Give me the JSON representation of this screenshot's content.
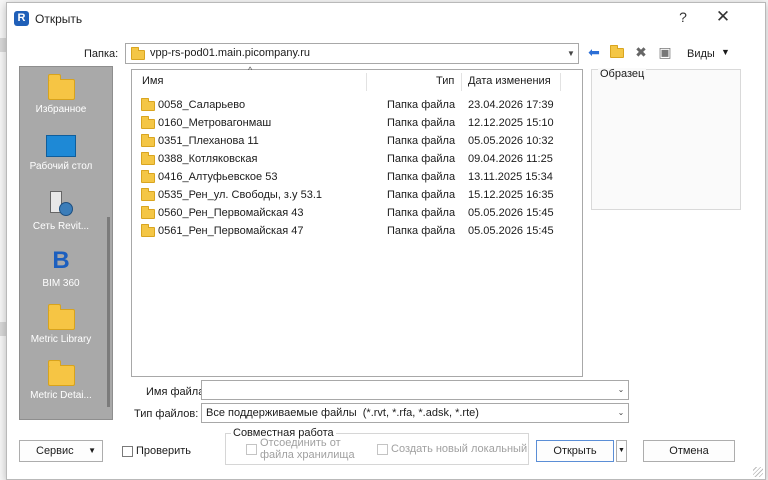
{
  "window": {
    "title": "Открыть",
    "help_label": "?",
    "close_label": "✕"
  },
  "location": {
    "label": "Папка:",
    "value": "vpp-rs-pod01.main.picompany.ru"
  },
  "toolbar": {
    "back_icon": "back-arrow-icon",
    "up_folder_icon": "up-folder-icon",
    "delete_icon": "delete-icon",
    "new_folder_icon": "new-folder-icon",
    "views_label": "Виды"
  },
  "places": [
    {
      "label": "Избранное",
      "icon": "folder-icon"
    },
    {
      "label": "Рабочий стол",
      "icon": "desktop-icon"
    },
    {
      "label": "Сеть Revit...",
      "icon": "network-icon"
    },
    {
      "label": "BIM 360",
      "icon": "bim360-icon"
    },
    {
      "label": "Metric Library",
      "icon": "folder-icon"
    },
    {
      "label": "Metric Detai...",
      "icon": "folder-icon"
    }
  ],
  "filelist": {
    "columns": {
      "name": "Имя",
      "type": "Тип",
      "date": "Дата изменения"
    },
    "rows": [
      {
        "name": "0058_Саларьево",
        "type": "Папка файла",
        "date": "23.04.2026 17:39"
      },
      {
        "name": "0160_Метровагонмаш",
        "type": "Папка файла",
        "date": "12.12.2025 15:10"
      },
      {
        "name": "0351_Плеханова 11",
        "type": "Папка файла",
        "date": "05.05.2026 10:32"
      },
      {
        "name": "0388_Котляковская",
        "type": "Папка файла",
        "date": "09.04.2026 11:25"
      },
      {
        "name": "0416_Алтуфьевское 53",
        "type": "Папка файла",
        "date": "13.11.2025 15:34"
      },
      {
        "name": "0535_Рен_ул. Свободы, з.у 53.1",
        "type": "Папка файла",
        "date": "15.12.2025 16:35"
      },
      {
        "name": "0560_Рен_Первомайская 43",
        "type": "Папка файла",
        "date": "05.05.2026 15:45"
      },
      {
        "name": "0561_Рен_Первомайская 47",
        "type": "Папка файла",
        "date": "05.05.2026 15:45"
      }
    ]
  },
  "preview": {
    "label": "Образец"
  },
  "filename": {
    "label": "Имя файла:",
    "value": ""
  },
  "filetype": {
    "label": "Тип файлов:",
    "value": "Все поддерживаемые файлы  (*.rvt, *.rfa, *.adsk, *.rte)"
  },
  "bottom": {
    "service_label": "Сервис",
    "check_label": "Проверить",
    "collab_group_label": "Совместная работа",
    "detach_label_1": "Отсоединить от",
    "detach_label_2": "файла хранилища",
    "create_local_label": "Создать новый локальный",
    "open_label": "Открыть",
    "cancel_label": "Отмена"
  }
}
